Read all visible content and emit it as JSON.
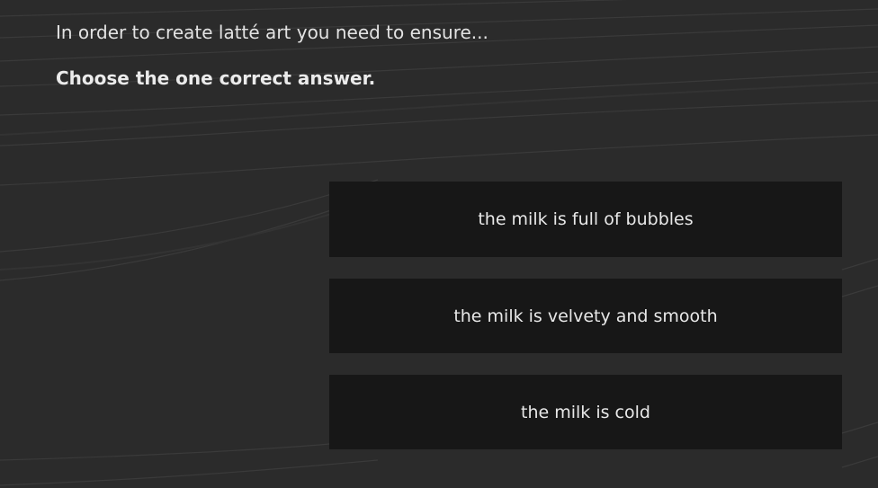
{
  "question": "In order to create latté art you need to ensure...",
  "instruction": "Choose the one correct answer.",
  "answers": [
    "the milk is full of bubbles",
    "the milk is velvety and smooth",
    "the milk is cold"
  ],
  "colors": {
    "background": "#2b2b2b",
    "answer_background": "#171717",
    "text": "#e8e8e8"
  }
}
